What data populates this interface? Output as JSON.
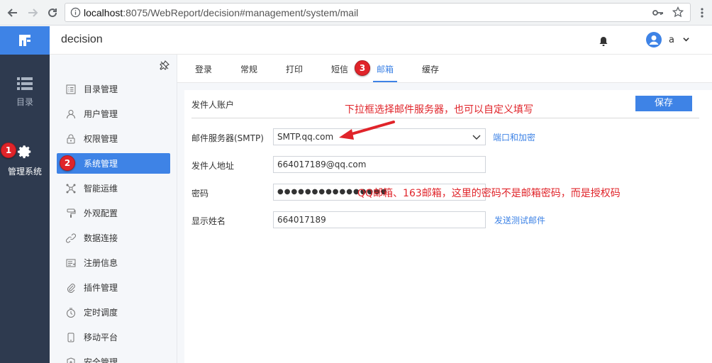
{
  "browser": {
    "url_host": "localhost",
    "url_rest": ":8075/WebReport/decision#management/system/mail"
  },
  "rail": {
    "items": [
      {
        "label": "目录"
      },
      {
        "label": "管理系统"
      }
    ]
  },
  "header": {
    "title": "decision",
    "user": "a"
  },
  "menu": {
    "items": [
      {
        "label": "目录管理"
      },
      {
        "label": "用户管理"
      },
      {
        "label": "权限管理"
      },
      {
        "label": "系统管理"
      },
      {
        "label": "智能运维"
      },
      {
        "label": "外观配置"
      },
      {
        "label": "数据连接"
      },
      {
        "label": "注册信息"
      },
      {
        "label": "插件管理"
      },
      {
        "label": "定时调度"
      },
      {
        "label": "移动平台"
      },
      {
        "label": "安全管理"
      }
    ],
    "active_index": 3
  },
  "tabs": {
    "items": [
      {
        "label": "登录"
      },
      {
        "label": "常规"
      },
      {
        "label": "打印"
      },
      {
        "label": "短信"
      },
      {
        "label": "邮箱"
      },
      {
        "label": "缓存"
      }
    ],
    "active_index": 4
  },
  "panel": {
    "section_title": "发件人账户",
    "save_label": "保存",
    "fields": {
      "smtp_label": "邮件服务器(SMTP)",
      "smtp_value": "SMTP.qq.com",
      "port_link": "端口和加密",
      "sender_label": "发件人地址",
      "sender_value": "664017189@qq.com",
      "password_label": "密码",
      "password_value": "●●●●●●●●●●●●●●●●",
      "display_label": "显示姓名",
      "display_value": "664017189",
      "test_link": "发送测试邮件"
    }
  },
  "annotations": {
    "badge1": "1",
    "badge2": "2",
    "badge3": "3",
    "note_smtp": "下拉框选择邮件服务器，也可以自定义填写",
    "note_password": "QQ邮箱、163邮箱，这里的密码不是邮箱密码，而是授权码"
  },
  "colors": {
    "accent": "#3e83e6",
    "rail_bg": "#2e3a4f",
    "annotation_red": "#e0242a"
  }
}
